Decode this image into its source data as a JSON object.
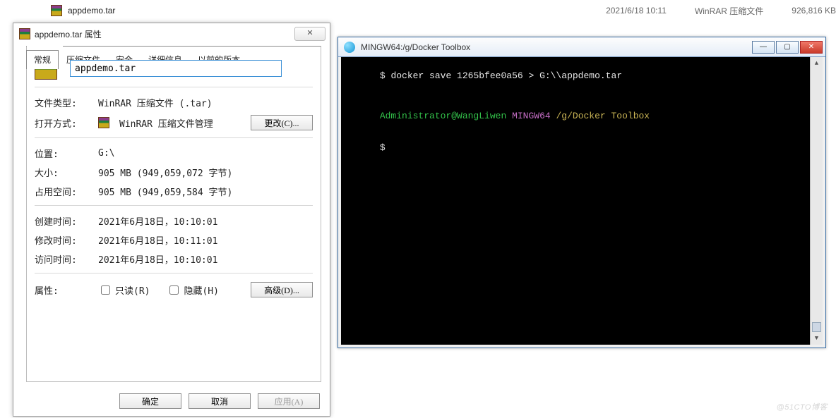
{
  "explorer": {
    "file_name": "appdemo.tar",
    "date": "2021/6/18 10:11",
    "type": "WinRAR 压缩文件",
    "size": "926,816 KB"
  },
  "properties": {
    "title": "appdemo.tar 属性",
    "tabs": [
      "常规",
      "压缩文件",
      "安全",
      "详细信息",
      "以前的版本"
    ],
    "filename_value": "appdemo.tar",
    "rows": {
      "file_type_label": "文件类型:",
      "file_type_value": "WinRAR 压缩文件 (.tar)",
      "open_with_label": "打开方式:",
      "open_with_value": "WinRAR 压缩文件管理",
      "change_btn": "更改(C)...",
      "location_label": "位置:",
      "location_value": "G:\\",
      "size_label": "大小:",
      "size_value": "905 MB (949,059,072 字节)",
      "disk_label": "占用空间:",
      "disk_value": "905 MB (949,059,584 字节)",
      "created_label": "创建时间:",
      "created_value": "2021年6月18日，10:10:01",
      "modified_label": "修改时间:",
      "modified_value": "2021年6月18日，10:11:01",
      "accessed_label": "访问时间:",
      "accessed_value": "2021年6月18日，10:10:01",
      "attr_label": "属性:",
      "readonly_label": "只读(R)",
      "hidden_label": "隐藏(H)",
      "advanced_btn": "高级(D)..."
    },
    "buttons": {
      "ok": "确定",
      "cancel": "取消",
      "apply": "应用(A)"
    }
  },
  "terminal": {
    "title": "MINGW64:/g/Docker Toolbox",
    "prompt": "$",
    "cmd": "docker save 1265bfee0a56 > G:\\\\appdemo.tar",
    "ps_user": "Administrator@WangLiwen",
    "ps_env": "MINGW64",
    "ps_path": "/g/Docker Toolbox"
  },
  "watermark": "@51CTO博客"
}
